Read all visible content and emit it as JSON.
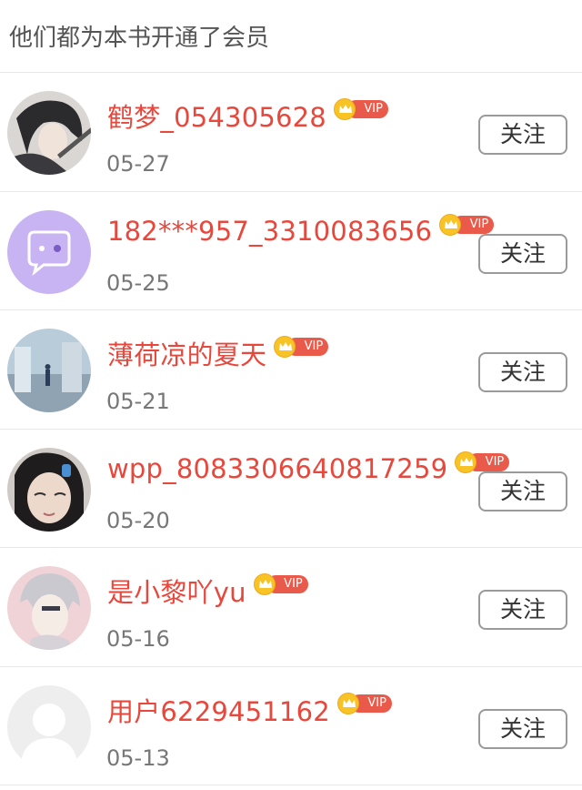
{
  "header": {
    "title": "他们都为本书开通了会员"
  },
  "vip_label": "VIP",
  "colors": {
    "name": "#e8473c",
    "vip_badge": "#ea5a4a",
    "crown": "#f7c325",
    "divider": "#e8e8e8"
  },
  "members": [
    {
      "name": "鹤梦_054305628",
      "date": "05-27",
      "follow_label": "关注",
      "avatar": "anime-dark-hair-avatar"
    },
    {
      "name": "182***957_3310083656",
      "date": "05-25",
      "follow_label": "关注",
      "avatar": "default-purple-chat-avatar"
    },
    {
      "name": "薄荷凉的夏天",
      "date": "05-21",
      "follow_label": "关注",
      "avatar": "street-scene-avatar"
    },
    {
      "name": "wpp_8083306640817259",
      "date": "05-20",
      "follow_label": "关注",
      "avatar": "girl-photo-avatar"
    },
    {
      "name": "是小黎吖yu",
      "date": "05-16",
      "follow_label": "关注",
      "avatar": "anime-silver-hair-avatar"
    },
    {
      "name": "用户6229451162",
      "date": "05-13",
      "follow_label": "关注",
      "avatar": "default-gray-avatar"
    }
  ]
}
